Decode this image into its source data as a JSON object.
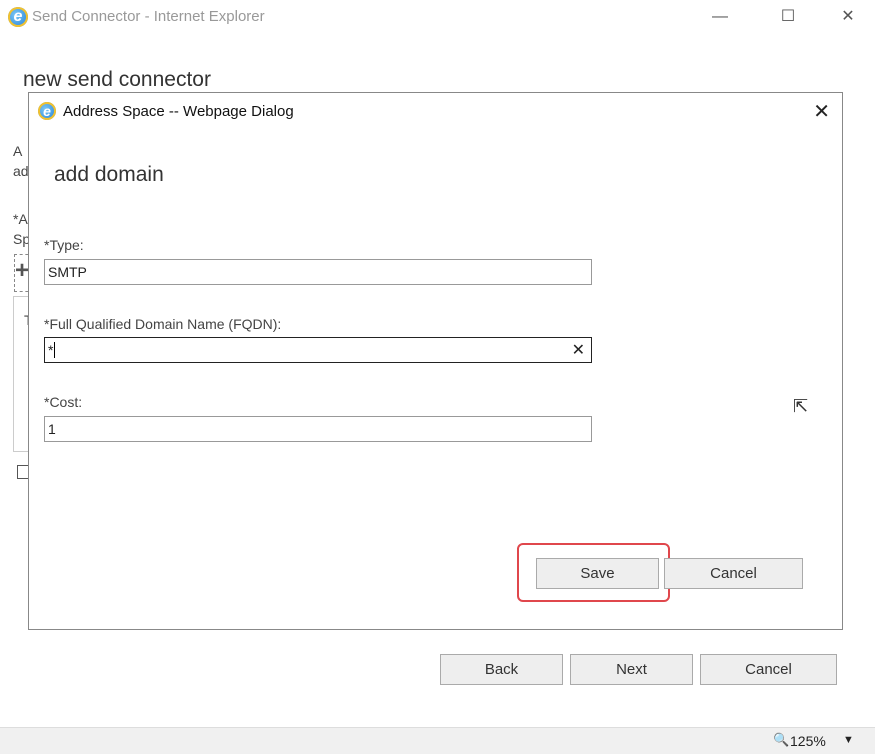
{
  "window": {
    "title": "Send Connector - Internet Explorer",
    "icon": "ie-icon",
    "controls": [
      "minimize",
      "maximize",
      "close"
    ]
  },
  "background_page": {
    "title": "new send connector",
    "fragments": [
      "A",
      "ad",
      "*A",
      "Sp",
      "T"
    ],
    "buttons": {
      "back": "Back",
      "next": "Next",
      "cancel": "Cancel"
    }
  },
  "dialog": {
    "title": "Address Space -- Webpage Dialog",
    "heading": "add domain",
    "fields": [
      {
        "label": "*Type:",
        "value": "SMTP"
      },
      {
        "label": "*Full Qualified Domain Name (FQDN):",
        "value": "*"
      },
      {
        "label": "*Cost:",
        "value": "1"
      }
    ],
    "save": "Save",
    "cancel": "Cancel",
    "highlight_color": "#e0474c"
  },
  "statusbar": {
    "zoom": "125%"
  }
}
